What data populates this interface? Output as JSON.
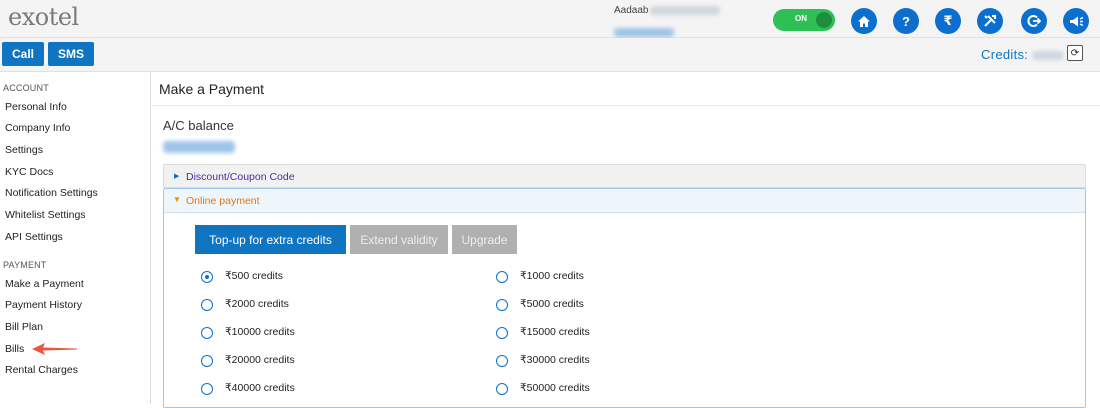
{
  "header": {
    "logo": "exotel",
    "greeting": "Aadaab",
    "toggle_label": "ON",
    "icons": [
      "home-icon",
      "help-icon",
      "rupee-icon",
      "tools-icon",
      "logout-icon",
      "announce-icon"
    ]
  },
  "subbar": {
    "call_label": "Call",
    "sms_label": "SMS",
    "credits_label": "Credits:"
  },
  "sidebar": {
    "account_heading": "ACCOUNT",
    "account_items": [
      "Personal Info",
      "Company Info",
      "Settings",
      "KYC Docs",
      "Notification Settings",
      "Whitelist Settings",
      "API Settings"
    ],
    "payment_heading": "PAYMENT",
    "payment_items": [
      "Make a Payment",
      "Payment History",
      "Bill Plan",
      "Bills",
      "Rental Charges"
    ]
  },
  "main": {
    "title": "Make a Payment",
    "balance_label": "A/C balance",
    "discount_label": "Discount/Coupon Code",
    "online_label": "Online payment",
    "tabs": [
      "Top-up for extra credits",
      "Extend validity",
      "Upgrade"
    ],
    "selected_option": "₹500 credits",
    "options_left": [
      "₹500 credits",
      "₹2000 credits",
      "₹10000 credits",
      "₹20000 credits",
      "₹40000 credits"
    ],
    "options_right": [
      "₹1000 credits",
      "₹5000 credits",
      "₹15000 credits",
      "₹30000 credits",
      "₹50000 credits"
    ]
  },
  "colors": {
    "brand_blue": "#0f74c2",
    "toggle_green": "#2fbf57",
    "annotation_arrow": "#e8573f"
  }
}
